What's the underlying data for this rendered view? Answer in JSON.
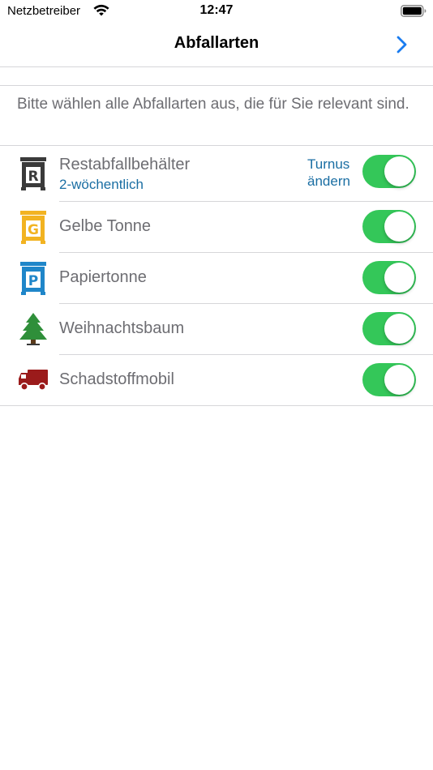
{
  "status_bar": {
    "carrier": "Netzbetreiber",
    "time": "12:47",
    "icons": [
      "wifi-icon",
      "battery-icon"
    ]
  },
  "nav": {
    "title": "Abfallarten",
    "forward_icon": "chevron-right-icon"
  },
  "instructions": "Bitte wählen alle Abfallarten aus, die für Sie relevant sind.",
  "waste_types": [
    {
      "label": "Restabfallbehälter",
      "subtitle": "2-wöchentlich",
      "action": "Turnus ändern",
      "icon": "residual-waste-bin-icon",
      "icon_letter": "R",
      "icon_color": "#3a3a3a",
      "enabled": true
    },
    {
      "label": "Gelbe Tonne",
      "icon": "yellow-bin-icon",
      "icon_letter": "G",
      "icon_color": "#f2b321",
      "enabled": true
    },
    {
      "label": "Papiertonne",
      "icon": "paper-bin-icon",
      "icon_letter": "P",
      "icon_color": "#1f86c9",
      "enabled": true
    },
    {
      "label": "Weihnachtsbaum",
      "icon": "christmas-tree-icon",
      "icon_color": "#2f8f3a",
      "enabled": true
    },
    {
      "label": "Schadstoffmobil",
      "icon": "hazardous-waste-truck-icon",
      "icon_color": "#9b1b1b",
      "enabled": true
    }
  ],
  "colors": {
    "accent": "#1a6ea3",
    "toggle_on": "#34c759",
    "nav_chevron": "#1a7cf0",
    "label_gray": "#6d6d72"
  }
}
